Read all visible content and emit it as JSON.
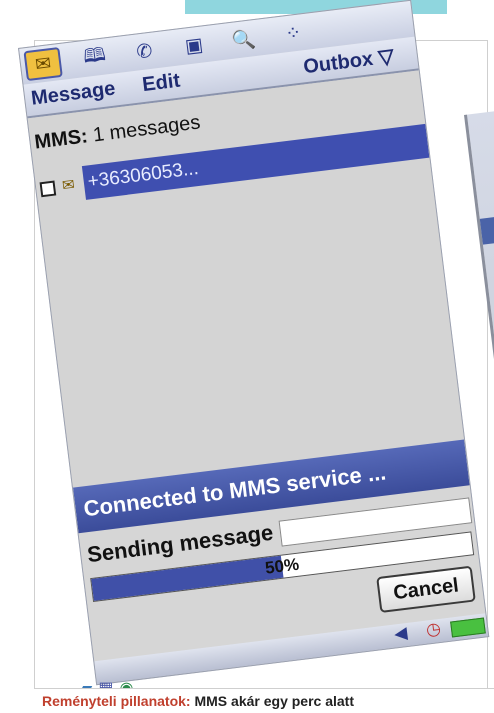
{
  "toolbar": {
    "icons": [
      "mail-icon",
      "book-icon",
      "phone-icon",
      "calendar-icon",
      "search-icon",
      "apps-icon"
    ],
    "glyphs": [
      "✉",
      "🕮",
      "✆",
      "▣",
      "🔍",
      "⁘"
    ]
  },
  "menu": {
    "message": "Message",
    "edit": "Edit",
    "outbox": "Outbox",
    "outbox_arrow": "▽"
  },
  "list": {
    "type_label": "MMS:",
    "count_text": "1 messages",
    "items": [
      {
        "recipient": "+36306053..."
      }
    ]
  },
  "dialog": {
    "title": "Connected to MMS service ...",
    "status": "Sending message",
    "progress_percent": 50,
    "progress_label": "50%",
    "cancel_label": "Cancel"
  },
  "statusbar": {
    "icons": [
      "speaker-icon",
      "clock-icon",
      "battery-icon"
    ],
    "glyphs": [
      "◀",
      "◷",
      ""
    ]
  },
  "taskbar": {
    "icons": [
      "chart-icon",
      "keyboard-icon",
      "globe-icon"
    ],
    "glyphs": [
      "▰",
      "▦",
      "◉"
    ]
  },
  "caption": {
    "lead": "Reményteli pillanatok:",
    "rest": "MMS akár egy perc alatt"
  },
  "colors": {
    "selection": "#3f4fb0",
    "dialog_title": "#4a5db0",
    "caption_lead": "#c0402e"
  }
}
